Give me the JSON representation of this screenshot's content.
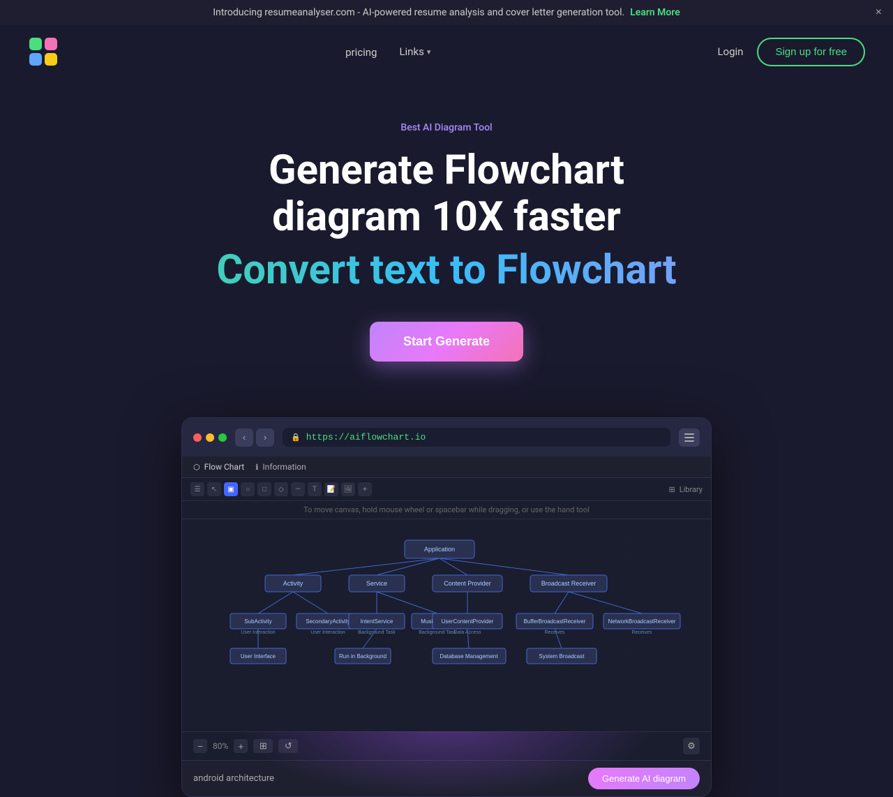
{
  "banner": {
    "text": "Introducing resumeanalyser.com - AI-powered resume analysis and cover letter generation tool.",
    "link_text": "Learn More",
    "close_label": "×"
  },
  "navbar": {
    "pricing_label": "pricing",
    "links_label": "Links",
    "login_label": "Login",
    "signup_label": "Sign up for free"
  },
  "hero": {
    "badge": "Best AI Diagram Tool",
    "title": "Generate Flowchart diagram 10X faster",
    "subtitle": "Convert text to Flowchart",
    "cta_label": "Start Generate"
  },
  "browser": {
    "address": "https://aiflowchart.io",
    "tab1": "Flow Chart",
    "tab2": "Information",
    "hint": "To move canvas, hold mouse wheel or spacebar while dragging, or use the hand tool",
    "zoom_label": "80%",
    "ai_input": "android architecture",
    "generate_label": "Generate AI diagram",
    "toolbar_right": "Library"
  }
}
